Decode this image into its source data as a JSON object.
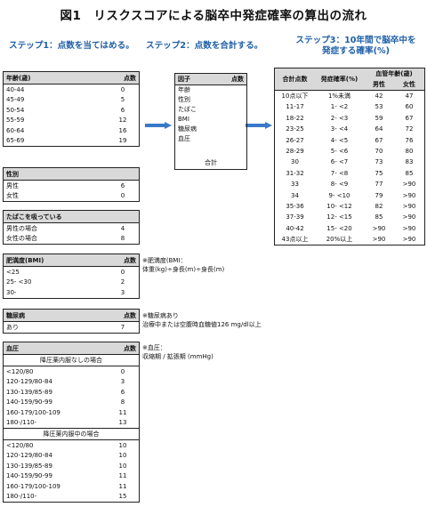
{
  "title": "図1　リスクスコアによる脳卒中発症確率の算出の流れ",
  "steps": {
    "s1": "ステップ1：点数を当てはめる。",
    "s2": "ステップ2：点数を合計する。",
    "s3_line1": "ステップ3：10年間で脳卒中を",
    "s3_line2": "発症する確率(%)"
  },
  "age": {
    "header": "年齢(歳)",
    "col": "点数",
    "rows": [
      [
        "40-44",
        "0"
      ],
      [
        "45-49",
        "5"
      ],
      [
        "50-54",
        "6"
      ],
      [
        "55-59",
        "12"
      ],
      [
        "60-64",
        "16"
      ],
      [
        "65-69",
        "19"
      ]
    ]
  },
  "sex": {
    "header": "性別",
    "col": "",
    "rows": [
      [
        "男性",
        "6"
      ],
      [
        "女性",
        "0"
      ]
    ]
  },
  "smoking": {
    "header": "たばこを吸っている",
    "col": "",
    "rows": [
      [
        "男性の場合",
        "4"
      ],
      [
        "女性の場合",
        "8"
      ]
    ]
  },
  "bmi": {
    "header": "肥満度(BMI)",
    "col": "点数",
    "rows": [
      [
        "<25",
        "0"
      ],
      [
        "25- <30",
        "2"
      ],
      [
        "30-",
        "3"
      ]
    ],
    "note1": "※肥満度(BMI：",
    "note2": "体重(kg)÷身長(m)÷身長(m)"
  },
  "diabetes": {
    "header": "糖尿病",
    "col": "点数",
    "rows": [
      [
        "あり",
        "7"
      ]
    ],
    "note1": "※糖尿病あり",
    "note2": "治療中または空腹時血糖値126 mg/dl以上"
  },
  "bp": {
    "header": "血圧",
    "col": "点数",
    "sub1": "降圧薬内服なしの場合",
    "rows1": [
      [
        "<120/80",
        "0"
      ],
      [
        "120-129/80-84",
        "3"
      ],
      [
        "130-139/85-89",
        "6"
      ],
      [
        "140-159/90-99",
        "8"
      ],
      [
        "160-179/100-109",
        "11"
      ],
      [
        "180-/110-",
        "13"
      ]
    ],
    "sub2": "降圧薬内服中の場合",
    "rows2": [
      [
        "<120/80",
        "10"
      ],
      [
        "120-129/80-84",
        "10"
      ],
      [
        "130-139/85-89",
        "10"
      ],
      [
        "140-159/90-99",
        "11"
      ],
      [
        "160-179/100-109",
        "11"
      ],
      [
        "180-/110-",
        "15"
      ]
    ],
    "note1": "※血圧：",
    "note2": "収縮期 / 拡張期 (mmHg)"
  },
  "factor": {
    "header": "因子",
    "col": "点数",
    "items": [
      "年齢",
      "性別",
      "たばこ",
      "BMI",
      "糖尿病",
      "血圧"
    ],
    "total": "合計"
  },
  "risk": {
    "h_total": "合計点数",
    "h_prob": "発症確率(%)",
    "h_age": "血管年齢(歳)",
    "h_male": "男性",
    "h_female": "女性",
    "rows": [
      [
        "10点以下",
        "1%未満",
        "42",
        "47"
      ],
      [
        "11-17",
        "1- <2",
        "53",
        "60"
      ],
      [
        "18-22",
        "2- <3",
        "59",
        "67"
      ],
      [
        "23-25",
        "3- <4",
        "64",
        "72"
      ],
      [
        "26-27",
        "4- <5",
        "67",
        "76"
      ],
      [
        "28-29",
        "5- <6",
        "70",
        "80"
      ],
      [
        "30",
        "6- <7",
        "73",
        "83"
      ],
      [
        "31-32",
        "7- <8",
        "75",
        "85"
      ],
      [
        "33",
        "8- <9",
        "77",
        ">90"
      ],
      [
        "34",
        "9- <10",
        "79",
        ">90"
      ],
      [
        "35-36",
        "10- <12",
        "82",
        ">90"
      ],
      [
        "37-39",
        "12- <15",
        "85",
        ">90"
      ],
      [
        "40-42",
        "15- <20",
        ">90",
        ">90"
      ],
      [
        "43点以上",
        "20%以上",
        ">90",
        ">90"
      ]
    ]
  }
}
